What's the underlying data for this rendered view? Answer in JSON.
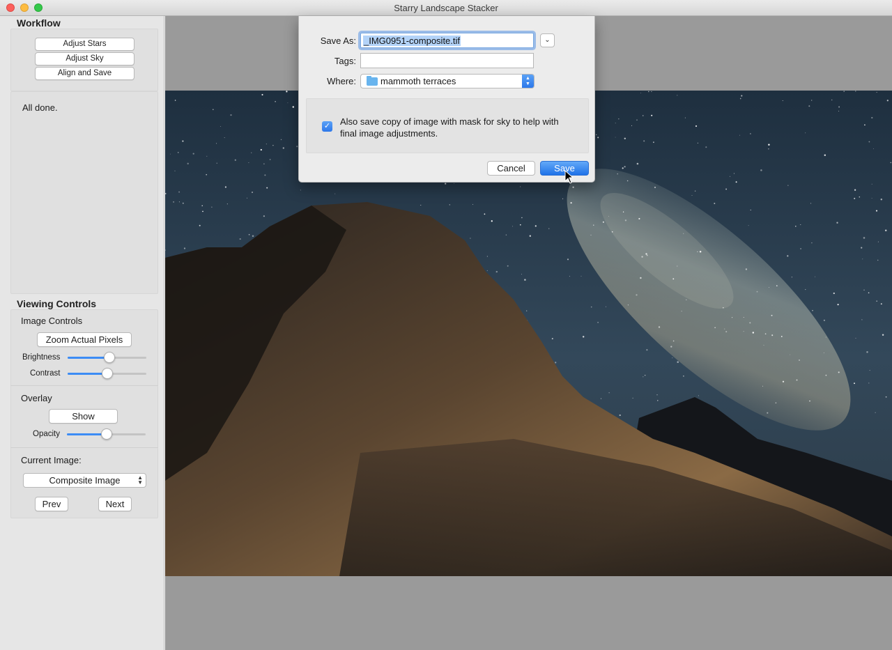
{
  "window": {
    "title": "Starry Landscape Stacker"
  },
  "sidebar": {
    "workflow_title": "Workflow",
    "workflow_buttons": [
      "Adjust Stars",
      "Adjust Sky",
      "Align and Save"
    ],
    "status_text": "All done.",
    "viewing_title": "Viewing Controls",
    "image_controls_label": "Image Controls",
    "zoom_button": "Zoom Actual Pixels",
    "brightness_label": "Brightness",
    "brightness_value": 0.53,
    "contrast_label": "Contrast",
    "contrast_value": 0.5,
    "overlay_label": "Overlay",
    "show_button": "Show",
    "opacity_label": "Opacity",
    "opacity_value": 0.5,
    "current_image_label": "Current Image:",
    "current_image_value": "Composite Image",
    "prev_button": "Prev",
    "next_button": "Next"
  },
  "dialog": {
    "save_as_label": "Save As:",
    "save_as_value": "_IMG0951-composite.tif",
    "tags_label": "Tags:",
    "tags_value": "",
    "where_label": "Where:",
    "where_value": "mammoth terraces",
    "checkbox_checked": true,
    "checkbox_text": "Also save copy of image with mask for sky to help with final image adjustments.",
    "cancel_button": "Cancel",
    "save_button": "Save"
  },
  "icons": {
    "expand": "chevron-down-icon",
    "folder": "folder-icon",
    "stepper": "up-down-arrows-icon",
    "check": "checkmark-icon",
    "cursor": "pointer-cursor-icon"
  },
  "colors": {
    "accent": "#2d78ea",
    "close": "#fc605c",
    "minimize": "#fdbc40",
    "maximize": "#34c84a"
  }
}
